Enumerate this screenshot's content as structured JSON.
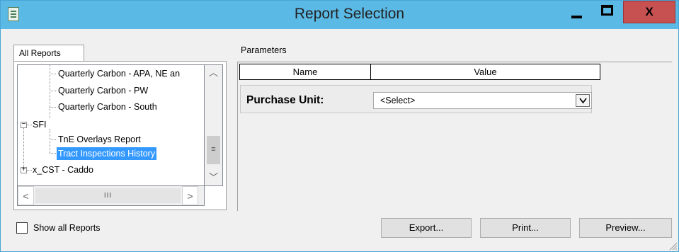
{
  "window": {
    "title": "Report Selection",
    "icon": "report-app-icon",
    "controls": {
      "minimize": "minimize-icon",
      "maximize": "maximize-icon",
      "close_label": "X"
    }
  },
  "left_panel": {
    "tab_label": "All Reports",
    "tree": [
      {
        "label": "Quarterly Carbon - APA, NE an",
        "level": 2
      },
      {
        "label": "Quarterly Carbon - PW",
        "level": 2
      },
      {
        "label": "Quarterly Carbon - South",
        "level": 2
      },
      {
        "label": "SFI",
        "level": 1,
        "expander": "⊟"
      },
      {
        "label": "TnE Overlays Report",
        "level": 2
      },
      {
        "label": "Tract Inspections History",
        "level": 2,
        "selected": true
      },
      {
        "label": "x_CST - Caddo",
        "level": 1,
        "expander": "⊞"
      }
    ],
    "scrollbar": {
      "up": "︿",
      "thumb": "≡",
      "down": "﹀",
      "left": "<",
      "hthumb": "III",
      "right": ">"
    },
    "show_all_label": "Show all Reports",
    "show_all_checked": false
  },
  "parameters": {
    "section_label": "Parameters",
    "columns": [
      "Name",
      "Value"
    ],
    "rows": [
      {
        "name": "Purchase Unit:",
        "value": "<Select>"
      }
    ]
  },
  "buttons": {
    "export": "Export...",
    "print": "Print...",
    "preview": "Preview..."
  },
  "colors": {
    "titlebar": "#5bb9e5",
    "close": "#c75050",
    "selection": "#3399ff"
  }
}
